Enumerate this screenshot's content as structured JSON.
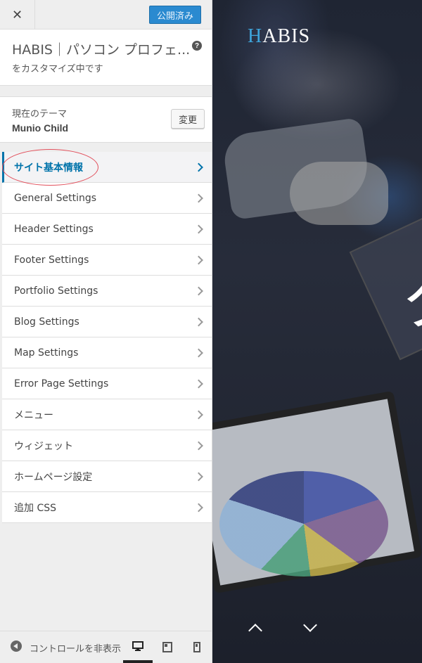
{
  "header": {
    "close_label": "✕",
    "publish_label": "公開済み"
  },
  "info": {
    "title": "HABIS｜パソコン プロフェ...",
    "subtitle": "をカスタマイズ中です",
    "help_glyph": "?"
  },
  "theme": {
    "label": "現在のテーマ",
    "name": "Munio Child",
    "change_label": "変更"
  },
  "menu": {
    "items": [
      {
        "label": "サイト基本情報",
        "active": true
      },
      {
        "label": "General Settings"
      },
      {
        "label": "Header Settings"
      },
      {
        "label": "Footer Settings"
      },
      {
        "label": "Portfolio Settings"
      },
      {
        "label": "Blog Settings"
      },
      {
        "label": "Map Settings"
      },
      {
        "label": "Error Page Settings"
      },
      {
        "label": "メニュー"
      },
      {
        "label": "ウィジェット"
      },
      {
        "label": "ホームページ設定"
      },
      {
        "label": "追加 CSS"
      }
    ]
  },
  "footer": {
    "collapse_label": "コントロールを非表示",
    "devices": [
      "desktop-icon",
      "tablet-icon",
      "mobile-icon"
    ],
    "active_device": "desktop"
  },
  "preview": {
    "brand_first": "H",
    "brand_rest": "ABIS",
    "hero_glyph": "ク"
  },
  "colors": {
    "accent": "#0073aa",
    "publish": "#2a8ad0",
    "highlight": "#e2505c",
    "brand_blue": "#3ea5dc"
  }
}
